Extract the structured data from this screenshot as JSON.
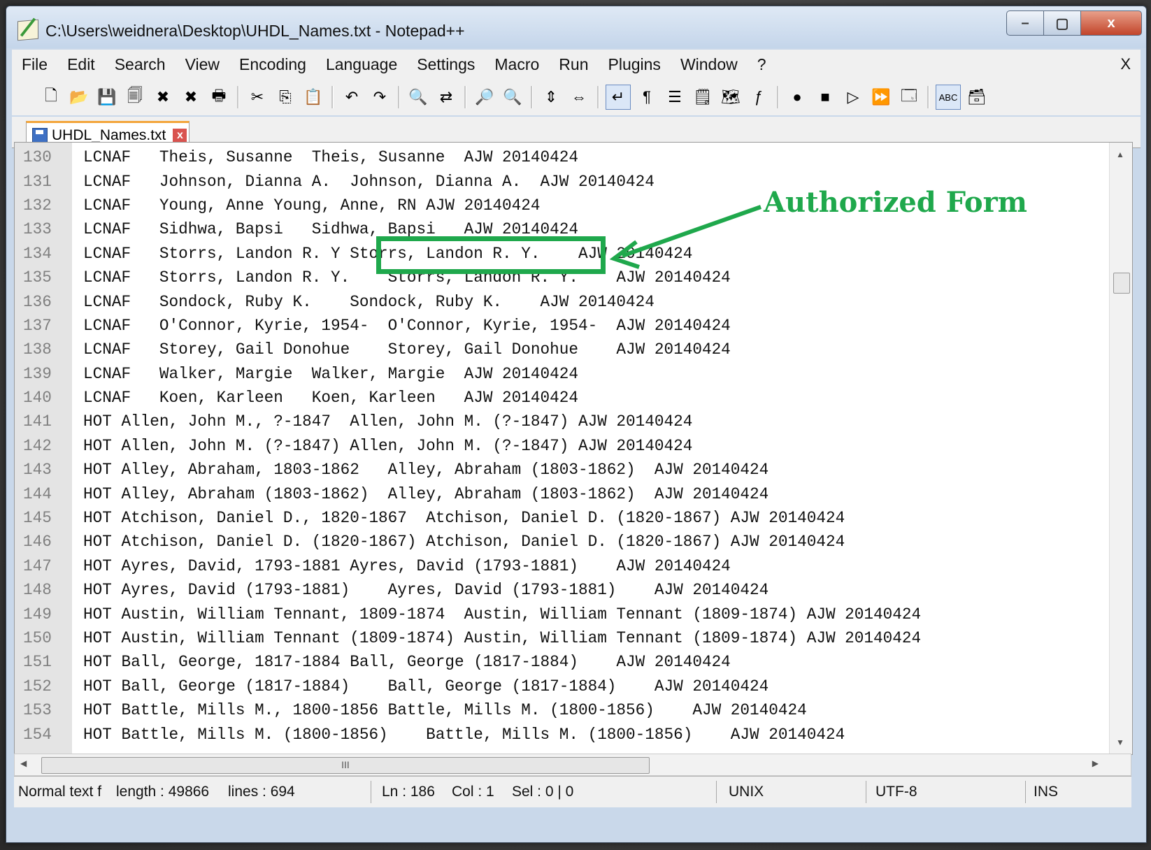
{
  "window": {
    "title": "C:\\Users\\weidnera\\Desktop\\UHDL_Names.txt - Notepad++",
    "minimize": "–",
    "maximize": "▢",
    "close": "x"
  },
  "menu": {
    "items": [
      "File",
      "Edit",
      "Search",
      "View",
      "Encoding",
      "Language",
      "Settings",
      "Macro",
      "Run",
      "Plugins",
      "Window",
      "?"
    ],
    "close": "X"
  },
  "toolbar": {
    "icons": [
      "new-file-icon",
      "open-file-icon",
      "save-icon",
      "save-all-icon",
      "close-icon",
      "close-all-icon",
      "print-icon",
      "sep",
      "cut-icon",
      "copy-icon",
      "paste-icon",
      "sep",
      "undo-icon",
      "redo-icon",
      "sep",
      "find-icon",
      "replace-icon",
      "sep",
      "zoom-in-icon",
      "zoom-out-icon",
      "sep",
      "sync-v-icon",
      "sync-h-icon",
      "sep",
      "word-wrap-icon",
      "show-all-chars-icon",
      "indent-guide-icon",
      "udl-icon",
      "doc-map-icon",
      "function-list-icon",
      "sep",
      "record-macro-icon",
      "stop-record-icon",
      "play-macro-icon",
      "run-macro-multiple-icon",
      "save-macro-icon",
      "sep",
      "spellcheck-icon",
      "hex-icon"
    ],
    "glyphs": [
      "🗋",
      "📂",
      "💾",
      "🗐",
      "✖",
      "✖",
      "🖶",
      "",
      "✂",
      "⎘",
      "📋",
      "",
      "↶",
      "↷",
      "",
      "🔍",
      "⇄",
      "",
      "🔎",
      "🔍",
      "",
      "⇕",
      "⇔",
      "",
      "↵",
      "¶",
      "☰",
      "🗒",
      "🗺",
      "ƒ",
      "",
      "●",
      "■",
      "▷",
      "⏩",
      "🗔",
      "",
      "ABC",
      "🗃"
    ]
  },
  "tab": {
    "label": "UHDL_Names.txt",
    "close": "x"
  },
  "editor": {
    "lines": [
      {
        "num": "130",
        "text": "LCNAF   Theis, Susanne  Theis, Susanne  AJW 20140424"
      },
      {
        "num": "131",
        "text": "LCNAF   Johnson, Dianna A.  Johnson, Dianna A.  AJW 20140424"
      },
      {
        "num": "132",
        "text": "LCNAF   Young, Anne Young, Anne, RN AJW 20140424"
      },
      {
        "num": "133",
        "text": "LCNAF   Sidhwa, Bapsi   Sidhwa, Bapsi   AJW 20140424"
      },
      {
        "num": "134",
        "text": "LCNAF   Storrs, Landon R. Y Storrs, Landon R. Y.    AJW 20140424"
      },
      {
        "num": "135",
        "text": "LCNAF   Storrs, Landon R. Y.    Storrs, Landon R. Y.    AJW 20140424"
      },
      {
        "num": "136",
        "text": "LCNAF   Sondock, Ruby K.    Sondock, Ruby K.    AJW 20140424"
      },
      {
        "num": "137",
        "text": "LCNAF   O'Connor, Kyrie, 1954-  O'Connor, Kyrie, 1954-  AJW 20140424"
      },
      {
        "num": "138",
        "text": "LCNAF   Storey, Gail Donohue    Storey, Gail Donohue    AJW 20140424"
      },
      {
        "num": "139",
        "text": "LCNAF   Walker, Margie  Walker, Margie  AJW 20140424"
      },
      {
        "num": "140",
        "text": "LCNAF   Koen, Karleen   Koen, Karleen   AJW 20140424"
      },
      {
        "num": "141",
        "text": "HOT Allen, John M., ?-1847  Allen, John M. (?-1847) AJW 20140424"
      },
      {
        "num": "142",
        "text": "HOT Allen, John M. (?-1847) Allen, John M. (?-1847) AJW 20140424"
      },
      {
        "num": "143",
        "text": "HOT Alley, Abraham, 1803-1862   Alley, Abraham (1803-1862)  AJW 20140424"
      },
      {
        "num": "144",
        "text": "HOT Alley, Abraham (1803-1862)  Alley, Abraham (1803-1862)  AJW 20140424"
      },
      {
        "num": "145",
        "text": "HOT Atchison, Daniel D., 1820-1867  Atchison, Daniel D. (1820-1867) AJW 20140424"
      },
      {
        "num": "146",
        "text": "HOT Atchison, Daniel D. (1820-1867) Atchison, Daniel D. (1820-1867) AJW 20140424"
      },
      {
        "num": "147",
        "text": "HOT Ayres, David, 1793-1881 Ayres, David (1793-1881)    AJW 20140424"
      },
      {
        "num": "148",
        "text": "HOT Ayres, David (1793-1881)    Ayres, David (1793-1881)    AJW 20140424"
      },
      {
        "num": "149",
        "text": "HOT Austin, William Tennant, 1809-1874  Austin, William Tennant (1809-1874) AJW 20140424"
      },
      {
        "num": "150",
        "text": "HOT Austin, William Tennant (1809-1874) Austin, William Tennant (1809-1874) AJW 20140424"
      },
      {
        "num": "151",
        "text": "HOT Ball, George, 1817-1884 Ball, George (1817-1884)    AJW 20140424"
      },
      {
        "num": "152",
        "text": "HOT Ball, George (1817-1884)    Ball, George (1817-1884)    AJW 20140424"
      },
      {
        "num": "153",
        "text": "HOT Battle, Mills M., 1800-1856 Battle, Mills M. (1800-1856)    AJW 20140424"
      },
      {
        "num": "154",
        "text": "HOT Battle, Mills M. (1800-1856)    Battle, Mills M. (1800-1856)    AJW 20140424"
      }
    ]
  },
  "hscroll": {
    "grip": "III"
  },
  "status": {
    "type": "Normal text f",
    "length": "length : 49866",
    "lines": "lines : 694",
    "ln": "Ln : 186",
    "col": "Col : 1",
    "sel": "Sel : 0 | 0",
    "eol": "UNIX",
    "encoding": "UTF-8",
    "mode": "INS"
  },
  "annotation": {
    "label": "Authorized Form",
    "color": "#1fa84c"
  }
}
